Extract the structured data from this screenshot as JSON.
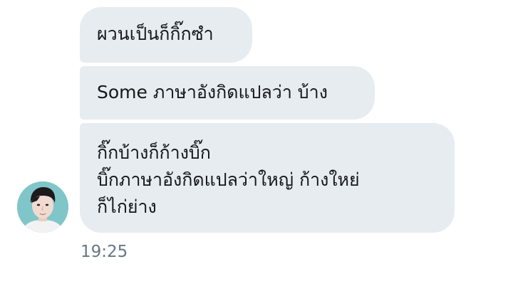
{
  "conversation": {
    "messages": [
      {
        "lines": [
          "ผวนเป็นก็กิ๊กซํา"
        ]
      },
      {
        "lines": [
          "Some ภาษาอังกิดแปลว่า บ้าง"
        ]
      },
      {
        "lines": [
          "กิ๊กบ้างก็ก้างบิ๊ก",
          "บิ๊กภาษาอังกิดแปลว่าใหญ่ ก้างใหย่",
          "ก็ไก่ย่าง"
        ]
      }
    ],
    "timestamp": "19:25"
  },
  "colors": {
    "bubble_bg": "#e6ecf0",
    "text": "#14171a",
    "timestamp": "#657786"
  },
  "icons": {
    "avatar": "user-avatar"
  }
}
